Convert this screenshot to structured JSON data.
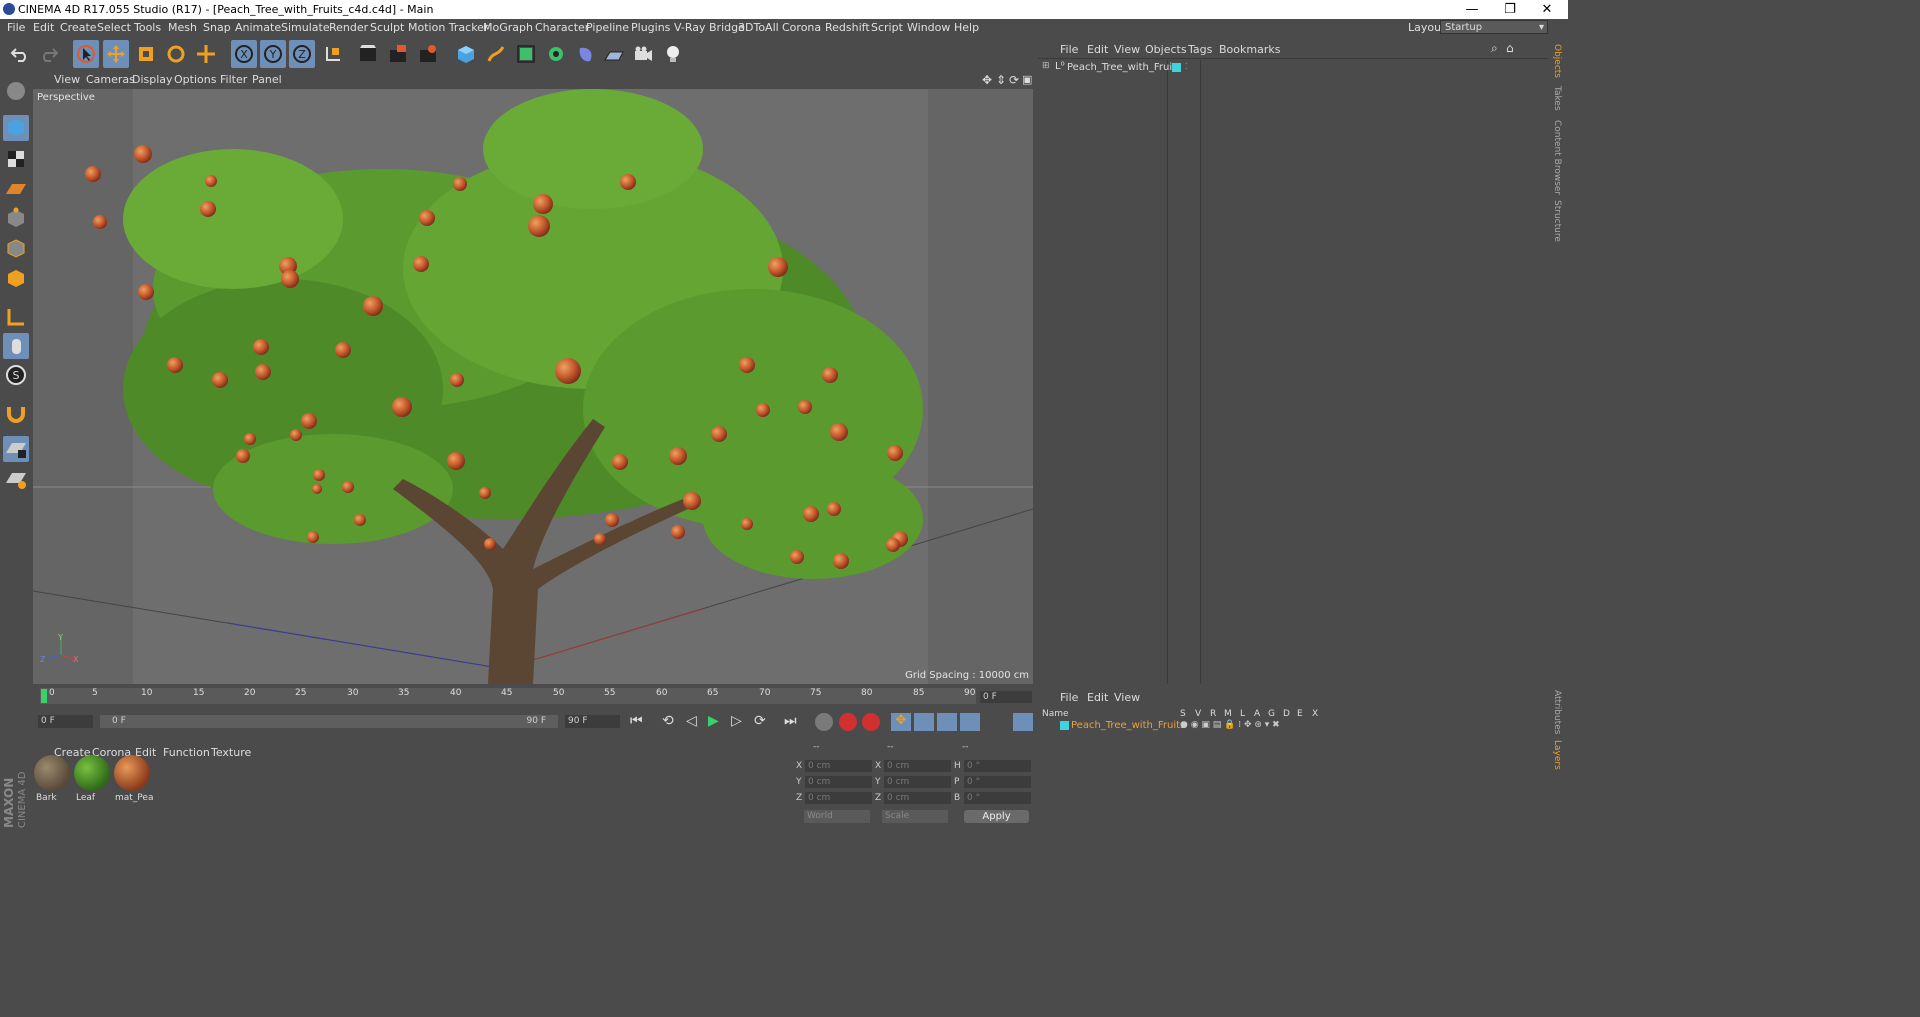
{
  "window": {
    "title": "CINEMA 4D R17.055 Studio (R17) - [Peach_Tree_with_Fruits_c4d.c4d] - Main",
    "minimize": "—",
    "restore": "❐",
    "close": "✕"
  },
  "menubar": {
    "items": [
      "File",
      "Edit",
      "Create",
      "Select",
      "Tools",
      "Mesh",
      "Snap",
      "Animate",
      "Simulate",
      "Render",
      "Sculpt",
      "Motion Tracker",
      "MoGraph",
      "Character",
      "Pipeline",
      "Plugins",
      "V-Ray Bridge",
      "3DToAll",
      "Corona",
      "Redshift",
      "Script",
      "Window",
      "Help"
    ],
    "layout_label": "Layout:",
    "layout_value": "Startup"
  },
  "toolbar": {
    "axis_x": "X",
    "axis_y": "Y",
    "axis_z": "Z",
    "icons": [
      "undo-icon",
      "redo-icon",
      "select-icon",
      "move-icon",
      "scale-icon",
      "rotate-icon",
      "transform-icon",
      "x-axis-icon",
      "y-axis-icon",
      "z-axis-icon",
      "coordinate-system-icon",
      "render-view-icon",
      "render-picture-viewer-icon",
      "render-settings-icon",
      "cube-icon",
      "pen-icon",
      "subdivision-icon",
      "mograph-cloner-icon",
      "deformer-icon",
      "floor-icon",
      "camera-icon",
      "light-icon"
    ]
  },
  "viewport": {
    "menu": [
      "View",
      "Cameras",
      "Display",
      "Options",
      "Filter",
      "Panel"
    ],
    "camera_label": "Perspective",
    "grid_spacing": "Grid Spacing : 10000 cm",
    "axis_labels": {
      "y": "Y",
      "x": "X",
      "z": "Z"
    }
  },
  "timeline": {
    "ticks": [
      "0",
      "5",
      "10",
      "15",
      "20",
      "25",
      "30",
      "35",
      "40",
      "45",
      "50",
      "55",
      "60",
      "65",
      "70",
      "75",
      "80",
      "85",
      "90"
    ],
    "current_frame": "0 F",
    "start_frame": "0 F",
    "range_start": "0 F",
    "range_end": "90 F",
    "end_frame": "90 F"
  },
  "materials": {
    "menu": [
      "Create",
      "Corona",
      "Edit",
      "Function",
      "Texture"
    ],
    "items": [
      {
        "name": "Bark",
        "color": "#6b5a43"
      },
      {
        "name": "Leaf",
        "color": "#4f8a2a"
      },
      {
        "name": "mat_Pea",
        "color": "#b8693a"
      }
    ]
  },
  "coordinates": {
    "headers": [
      "--",
      "--",
      "--"
    ],
    "rows": [
      {
        "l1": "X",
        "v1": "0 cm",
        "l2": "X",
        "v2": "0 cm",
        "l3": "H",
        "v3": "0 °"
      },
      {
        "l1": "Y",
        "v1": "0 cm",
        "l2": "Y",
        "v2": "0 cm",
        "l3": "P",
        "v3": "0 °"
      },
      {
        "l1": "Z",
        "v1": "0 cm",
        "l2": "Z",
        "v2": "0 cm",
        "l3": "B",
        "v3": "0 °"
      }
    ],
    "world": "World",
    "scale": "Scale",
    "apply": "Apply"
  },
  "objects_panel": {
    "menu": [
      "File",
      "Edit",
      "View",
      "Objects",
      "Tags",
      "Bookmarks"
    ],
    "object_name": "Peach_Tree_with_Fruits",
    "layer_color": "#3fd3e0"
  },
  "layers_panel": {
    "menu": [
      "File",
      "Edit",
      "View"
    ],
    "name_header": "Name",
    "columns": [
      "S",
      "V",
      "R",
      "M",
      "L",
      "A",
      "G",
      "D",
      "E",
      "X"
    ],
    "layer_name": "Peach_Tree_with_Fruits",
    "layer_name_color": "#e8a23a"
  },
  "right_tabs": [
    "Objects",
    "Takes",
    "Content Browser",
    "Structure",
    "Attributes",
    "Layers"
  ],
  "brand": {
    "line1": "MAXON",
    "line2": "CINEMA 4D"
  }
}
